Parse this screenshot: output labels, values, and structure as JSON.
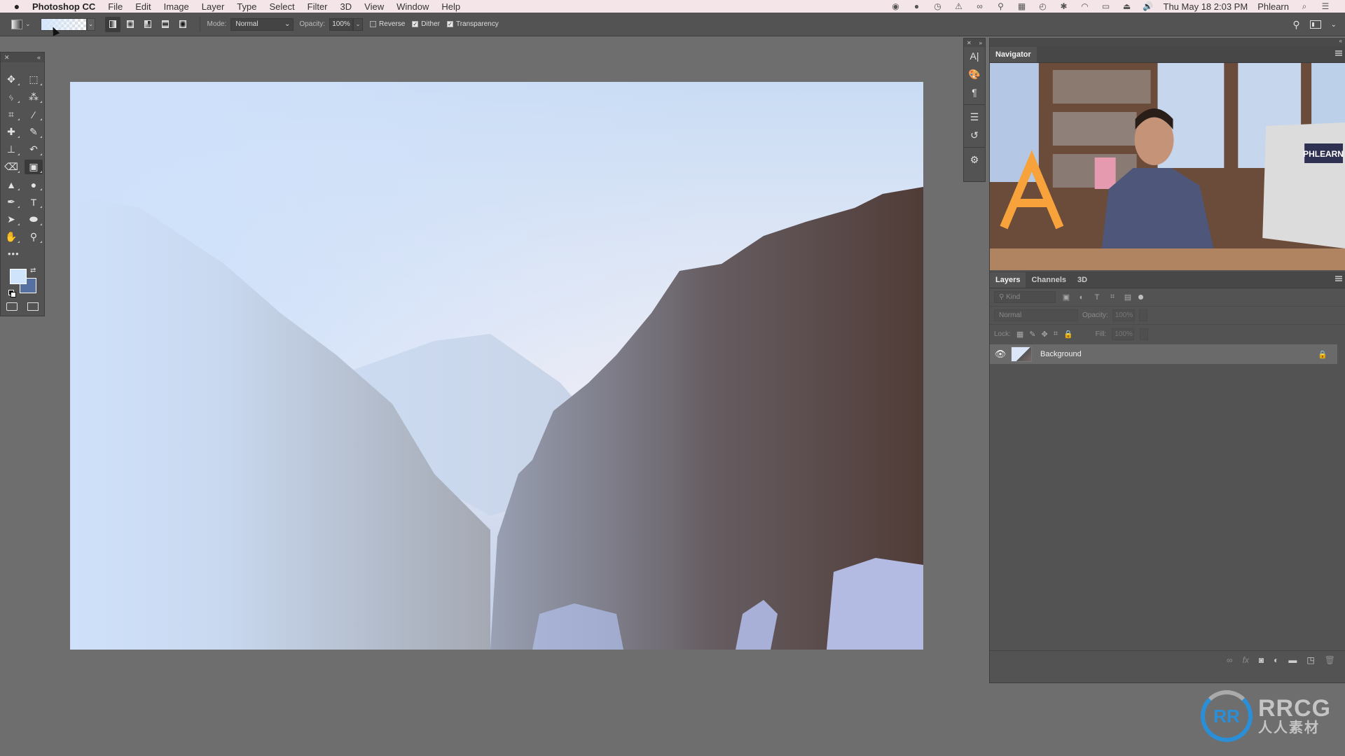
{
  "menubar": {
    "apple_icon": "apple-logo",
    "app_name": "Photoshop CC",
    "menus": [
      "File",
      "Edit",
      "Image",
      "Layer",
      "Type",
      "Select",
      "Filter",
      "3D",
      "View",
      "Window",
      "Help"
    ],
    "status_icons": [
      "record-icon",
      "chat-icon",
      "clock-icon",
      "alert-icon",
      "creative-cloud-icon",
      "pin-icon",
      "display-icon",
      "time-machine-icon",
      "bluetooth-icon",
      "wifi-icon",
      "airplay-icon",
      "eject-icon",
      "volume-icon"
    ],
    "datetime": "Thu May 18  2:03 PM",
    "user": "Phlearn"
  },
  "options_bar": {
    "gradient_preview_colors": [
      "#d4e6fb",
      "transparent"
    ],
    "gradient_types": [
      "Linear",
      "Radial",
      "Angle",
      "Reflected",
      "Diamond"
    ],
    "active_gradient_type": "Linear",
    "mode_label": "Mode:",
    "mode_value": "Normal",
    "opacity_label": "Opacity:",
    "opacity_value": "100%",
    "reverse_label": "Reverse",
    "reverse_checked": false,
    "dither_label": "Dither",
    "dither_checked": true,
    "transparency_label": "Transparency",
    "transparency_checked": true
  },
  "toolbar": {
    "tools": [
      {
        "name": "move-tool",
        "glyph": "✥"
      },
      {
        "name": "marquee-tool",
        "glyph": "⬚"
      },
      {
        "name": "lasso-tool",
        "glyph": "ᛃ"
      },
      {
        "name": "magic-wand-tool",
        "glyph": "⁂"
      },
      {
        "name": "crop-tool",
        "glyph": "⌗"
      },
      {
        "name": "eyedropper-tool",
        "glyph": "⁄"
      },
      {
        "name": "healing-brush-tool",
        "glyph": "✚"
      },
      {
        "name": "brush-tool",
        "glyph": "✎"
      },
      {
        "name": "clone-stamp-tool",
        "glyph": "⊥"
      },
      {
        "name": "history-brush-tool",
        "glyph": "↶"
      },
      {
        "name": "eraser-tool",
        "glyph": "⌫"
      },
      {
        "name": "gradient-tool",
        "glyph": "▣"
      },
      {
        "name": "blur-tool",
        "glyph": "▲"
      },
      {
        "name": "dodge-tool",
        "glyph": "●"
      },
      {
        "name": "pen-tool",
        "glyph": "✒"
      },
      {
        "name": "type-tool",
        "glyph": "T"
      },
      {
        "name": "path-selection-tool",
        "glyph": "➤"
      },
      {
        "name": "ellipse-tool",
        "glyph": "⬬"
      },
      {
        "name": "hand-tool",
        "glyph": "✋"
      },
      {
        "name": "zoom-tool",
        "glyph": "⚲"
      }
    ],
    "active_tool": "gradient-tool",
    "more_glyph": "•••",
    "foreground_color": "#cfe3fa",
    "background_color": "#5670a1"
  },
  "icon_strip": {
    "icons": [
      {
        "name": "character-icon",
        "glyph": "A|"
      },
      {
        "name": "swatches-icon",
        "glyph": "🎨"
      },
      {
        "name": "paragraph-icon",
        "glyph": "¶"
      },
      {
        "name": "clone-source-icon",
        "glyph": "☰"
      },
      {
        "name": "history-icon",
        "glyph": "↺"
      },
      {
        "name": "properties-icon",
        "glyph": "⚙"
      }
    ]
  },
  "navigator": {
    "tab_label": "Navigator",
    "monitor_label": "PHLEARN"
  },
  "layers_panel": {
    "tabs": [
      "Layers",
      "Channels",
      "3D"
    ],
    "active_tab": "Layers",
    "kind_placeholder": "Kind",
    "blend_mode": "Normal",
    "opacity_label": "Opacity:",
    "opacity_value": "100%",
    "lock_label": "Lock:",
    "fill_label": "Fill:",
    "fill_value": "100%",
    "layers": [
      {
        "name": "Background",
        "visible": true,
        "locked": true
      }
    ],
    "footer_icons": [
      "link-icon",
      "fx-icon",
      "mask-icon",
      "adjustment-icon",
      "folder-icon",
      "new-layer-icon",
      "trash-icon"
    ]
  },
  "watermark": {
    "brand": "RRCG",
    "subtitle": "人人素材",
    "logo_glyph": "RR"
  }
}
